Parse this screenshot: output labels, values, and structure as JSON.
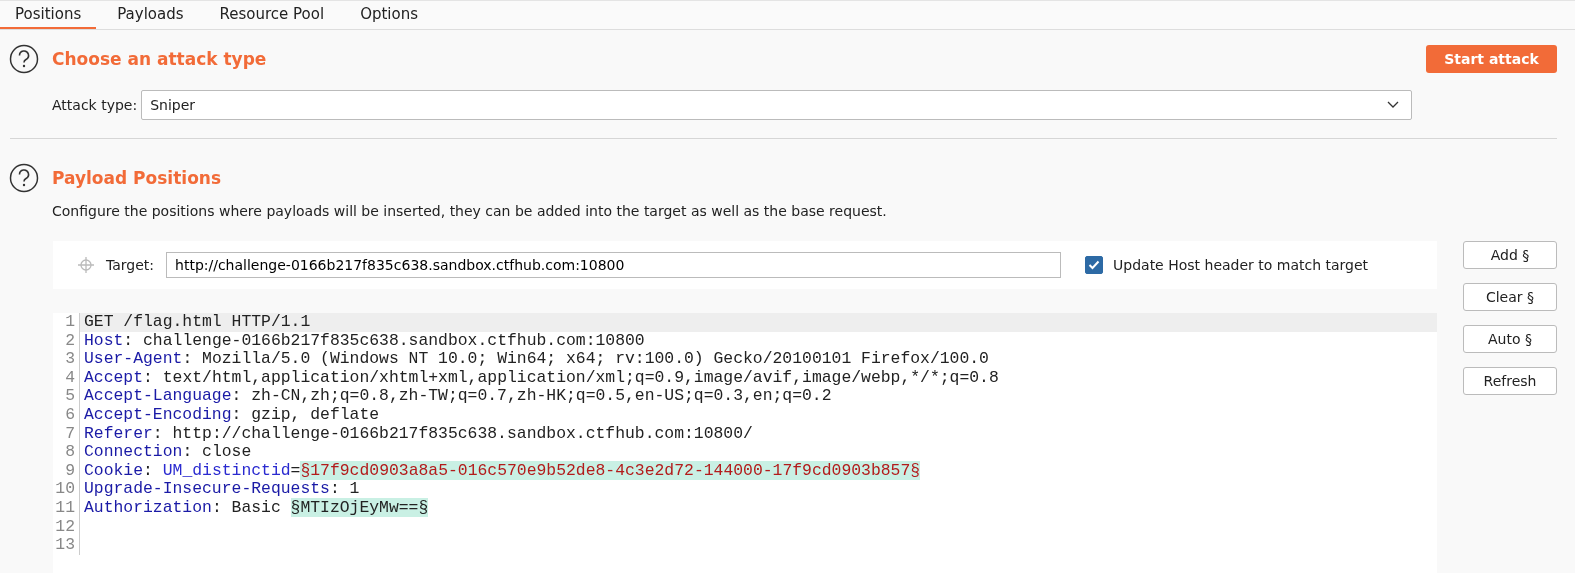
{
  "tabs": [
    {
      "label": "Positions",
      "selected": true
    },
    {
      "label": "Payloads",
      "selected": false
    },
    {
      "label": "Resource Pool",
      "selected": false
    },
    {
      "label": "Options",
      "selected": false
    }
  ],
  "attack_section": {
    "title": "Choose an attack type",
    "start_button": "Start attack",
    "attack_type_label": "Attack type:",
    "attack_type_value": "Sniper"
  },
  "positions_section": {
    "title": "Payload Positions",
    "description": "Configure the positions where payloads will be inserted, they can be added into the target as well as the base request.",
    "target_label": "Target:",
    "target_value": "http://challenge-0166b217f835c638.sandbox.ctfhub.com:10800",
    "update_host": {
      "label": "Update Host header to match target",
      "checked": true
    },
    "buttons": [
      "Add §",
      "Clear §",
      "Auto §",
      "Refresh"
    ],
    "editor_lines": [
      {
        "number": "1",
        "selected": true,
        "segments": [
          {
            "kind": "text",
            "text": "GET /flag.html HTTP/1.1"
          }
        ]
      },
      {
        "number": "2",
        "selected": false,
        "segments": [
          {
            "kind": "name",
            "text": "Host"
          },
          {
            "kind": "text",
            "text": ": challenge-0166b217f835c638.sandbox.ctfhub.com:10800"
          }
        ]
      },
      {
        "number": "3",
        "selected": false,
        "segments": [
          {
            "kind": "name",
            "text": "User-Agent"
          },
          {
            "kind": "text",
            "text": ": Mozilla/5.0 (Windows NT 10.0; Win64; x64; rv:100.0) Gecko/20100101 Firefox/100.0"
          }
        ]
      },
      {
        "number": "4",
        "selected": false,
        "segments": [
          {
            "kind": "name",
            "text": "Accept"
          },
          {
            "kind": "text",
            "text": ": text/html,application/xhtml+xml,application/xml;q=0.9,image/avif,image/webp,*/*;q=0.8"
          }
        ]
      },
      {
        "number": "5",
        "selected": false,
        "segments": [
          {
            "kind": "name",
            "text": "Accept-Language"
          },
          {
            "kind": "text",
            "text": ": zh-CN,zh;q=0.8,zh-TW;q=0.7,zh-HK;q=0.5,en-US;q=0.3,en;q=0.2"
          }
        ]
      },
      {
        "number": "6",
        "selected": false,
        "segments": [
          {
            "kind": "name",
            "text": "Accept-Encoding"
          },
          {
            "kind": "text",
            "text": ": gzip, deflate"
          }
        ]
      },
      {
        "number": "7",
        "selected": false,
        "segments": [
          {
            "kind": "name",
            "text": "Referer"
          },
          {
            "kind": "text",
            "text": ": http://challenge-0166b217f835c638.sandbox.ctfhub.com:10800/"
          }
        ]
      },
      {
        "number": "8",
        "selected": false,
        "segments": [
          {
            "kind": "name",
            "text": "Connection"
          },
          {
            "kind": "text",
            "text": ": close"
          }
        ]
      },
      {
        "number": "9",
        "selected": false,
        "segments": [
          {
            "kind": "name",
            "text": "Cookie"
          },
          {
            "kind": "text",
            "text": ": "
          },
          {
            "kind": "param",
            "text": "UM_distinctid"
          },
          {
            "kind": "text",
            "text": "="
          },
          {
            "kind": "payload",
            "text": "§17f9cd0903a8a5-016c570e9b52de8-4c3e2d72-144000-17f9cd0903b857§"
          }
        ]
      },
      {
        "number": "10",
        "selected": false,
        "segments": [
          {
            "kind": "name",
            "text": "Upgrade-Insecure-Requests"
          },
          {
            "kind": "text",
            "text": ": 1"
          }
        ]
      },
      {
        "number": "11",
        "selected": false,
        "segments": [
          {
            "kind": "name",
            "text": "Authorization"
          },
          {
            "kind": "text",
            "text": ": Basic "
          },
          {
            "kind": "payload_plain",
            "text": "§MTIzOjEyMw==§"
          }
        ]
      },
      {
        "number": "12",
        "selected": false
      },
      {
        "number": "13",
        "selected": false
      }
    ]
  }
}
